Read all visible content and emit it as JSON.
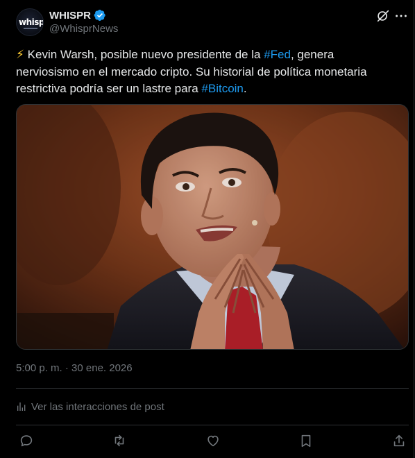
{
  "author": {
    "display_name": "WHISPR",
    "handle": "@WhisprNews",
    "verified": true,
    "avatar_logo": "whispr",
    "avatar_logo_main": "whisp",
    "avatar_logo_accent": "r"
  },
  "header_icons": [
    "grok-icon",
    "more-icon"
  ],
  "tweet": {
    "line1_emoji": "⚡",
    "line1_pre": " Kevin Warsh, posible nuevo presidente de la ",
    "hashtag_fed": "#Fed",
    "line1_post": ", genera",
    "line2": "nerviosismo en el mercado cripto. Su historial de política monetaria",
    "line3_pre": "restrictiva podría ser un lastre para ",
    "hashtag_bitcoin": "#Bitcoin",
    "line3_post": "."
  },
  "media": {
    "description_icon": "photo-of-man-with-steepled-hands"
  },
  "meta": {
    "timestamp": "5:00 p. m. · 30 ene. 2026",
    "analytics_label": "Ver las interacciones de post"
  },
  "actions": [
    "reply-icon",
    "retweet-icon",
    "like-icon",
    "bookmark-icon",
    "share-icon"
  ],
  "colors": {
    "background": "#000000",
    "text": "#e7e9ea",
    "secondary_text": "#71767b",
    "link": "#1d9bf0",
    "divider": "#2f3336",
    "verified": "#1d9bf0"
  }
}
